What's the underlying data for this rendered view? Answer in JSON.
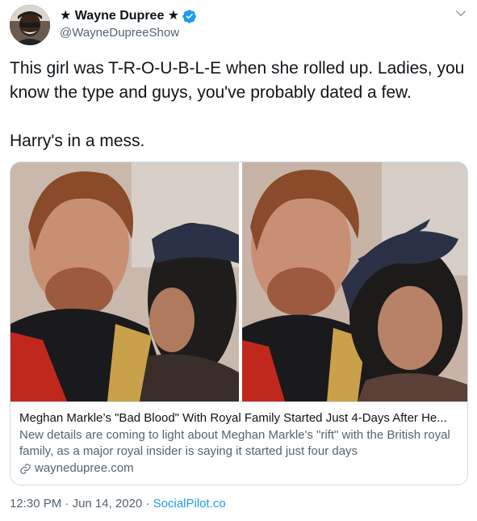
{
  "author": {
    "display_name": "★ Wayne Dupree ★",
    "handle": "@WayneDupreeShow",
    "avatar_icon": "avatar-photo",
    "verified_icon": "verified-badge-icon"
  },
  "tweet": {
    "paragraphs": [
      "This girl was T-R-O-U-B-L-E when she rolled up. Ladies, you know the type and guys, you've probably dated a few.",
      "Harry's in a mess."
    ]
  },
  "card": {
    "title": "Meghan Markle’s \"Bad Blood\" With Royal Family Started Just 4-Days After He...",
    "description": "New details are coming to light about Meghan Markle's \"rift\" with the British royal family, as a major royal insider is saying it started just four days",
    "domain": "waynedupree.com",
    "link_icon": "link-icon"
  },
  "meta": {
    "time": "12:30 PM",
    "separator": "·",
    "date": "Jun 14, 2020",
    "source": "SocialPilot.co"
  },
  "colors": {
    "accent": "#1d9bf0",
    "text": "#0f1419",
    "secondary": "#536471",
    "border": "#cfd9de"
  }
}
